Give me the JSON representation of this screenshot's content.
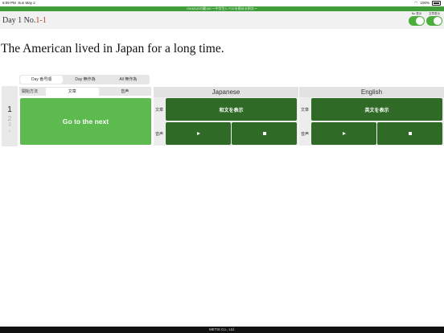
{
  "status": {
    "time": "6:09 PM",
    "date": "Sun May 2",
    "battery": "100%"
  },
  "banner": "ISHIZUEの鍵160 〜中学生レベルを極める例文〜",
  "header": {
    "day_prefix": "Day 1 No.",
    "day_num": "1-1",
    "toggle_no_label": "No.表示",
    "toggle_auto_label": "文章表示"
  },
  "sentence": "The American lived in Japan for a long time.",
  "left": {
    "tabs": [
      "Day 番号順",
      "Day 無作為",
      "All 無作為"
    ],
    "numbers": [
      "1",
      "2",
      "3",
      "4"
    ],
    "mode_label": "開始方法",
    "mode_options": [
      "文章",
      "音声"
    ],
    "next_label": "Go to the next"
  },
  "japanese": {
    "title": "Japanese",
    "text_label": "文章",
    "voice_label": "音声",
    "show_button": "和文を表示"
  },
  "english": {
    "title": "English",
    "text_label": "文章",
    "voice_label": "音声",
    "show_button": "英文を表示"
  },
  "icons": {
    "play": "play-icon",
    "stop": "stop-icon",
    "wifi": "wifi-icon",
    "battery": "battery-icon"
  },
  "colors": {
    "accent": "#4cae3a",
    "button_dark": "#2f6b27",
    "button_light": "#5dba4e",
    "number_red": "#c0392b"
  },
  "footer": "METIS Co., Ltd."
}
